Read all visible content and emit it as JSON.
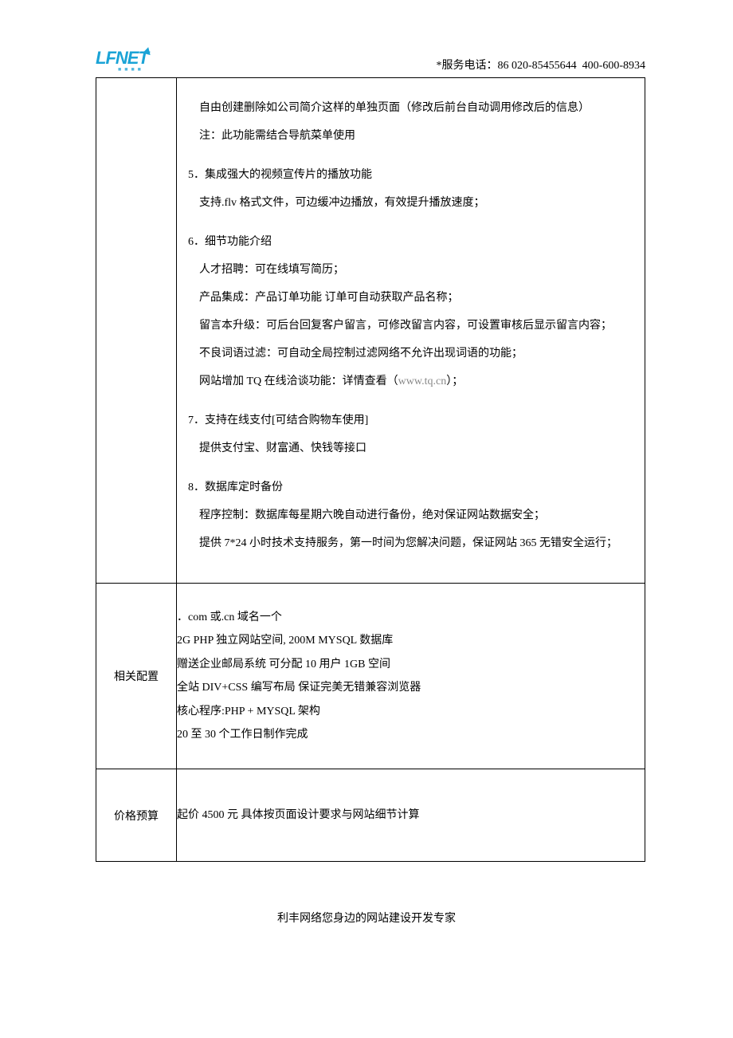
{
  "header": {
    "logo_text": "LFNET",
    "service_prefix": "*服务电话：",
    "tel1": "86 020-85455644",
    "tel2": "400-600-8934"
  },
  "row1": {
    "p1": "自由创建删除如公司简介这样的单独页面（修改后前台自动调用修改后的信息）",
    "p2": "注：此功能需结合导航菜单使用",
    "s5_title": "5．集成强大的视频宣传片的播放功能",
    "s5_l1": "支持.flv 格式文件，可边缓冲边播放，有效提升播放速度；",
    "s6_title": "6．细节功能介绍",
    "s6_l1": "人才招聘：可在线填写简历；",
    "s6_l2": "产品集成：产品订单功能 订单可自动获取产品名称；",
    "s6_l3": "留言本升级：可后台回复客户留言，可修改留言内容，可设置审核后显示留言内容；",
    "s6_l4": "不良词语过滤：可自动全局控制过滤网络不允许出现词语的功能；",
    "s6_l5a": "网站增加 TQ 在线洽谈功能：详情查看（",
    "s6_link": "www.tq.cn",
    "s6_l5b": "）；",
    "s7_title": "7．支持在线支付[可结合购物车使用]",
    "s7_l1": "提供支付宝、财富通、快钱等接口",
    "s8_title": "8．数据库定时备份",
    "s8_l1": "程序控制：数据库每星期六晚自动进行备份，绝对保证网站数据安全；",
    "s8_l2": "提供 7*24 小时技术支持服务，第一时间为您解决问题，保证网站 365 无错安全运行；"
  },
  "row2": {
    "label": "相关配置",
    "l1": "．com 或.cn 域名一个",
    "l2": "2G  PHP 独立网站空间, 200M  MYSQL 数据库",
    "l3": "赠送企业邮局系统   可分配 10 用户 1GB 空间",
    "l4": "全站 DIV+CSS 编写布局 保证完美无错兼容浏览器",
    "l5": "核心程序:PHP + MYSQL 架构",
    "l6": "20 至 30 个工作日制作完成"
  },
  "row3": {
    "label": "价格预算",
    "text": "起价 4500 元    具体按页面设计要求与网站细节计算"
  },
  "footer": "利丰网络您身边的网站建设开发专家"
}
